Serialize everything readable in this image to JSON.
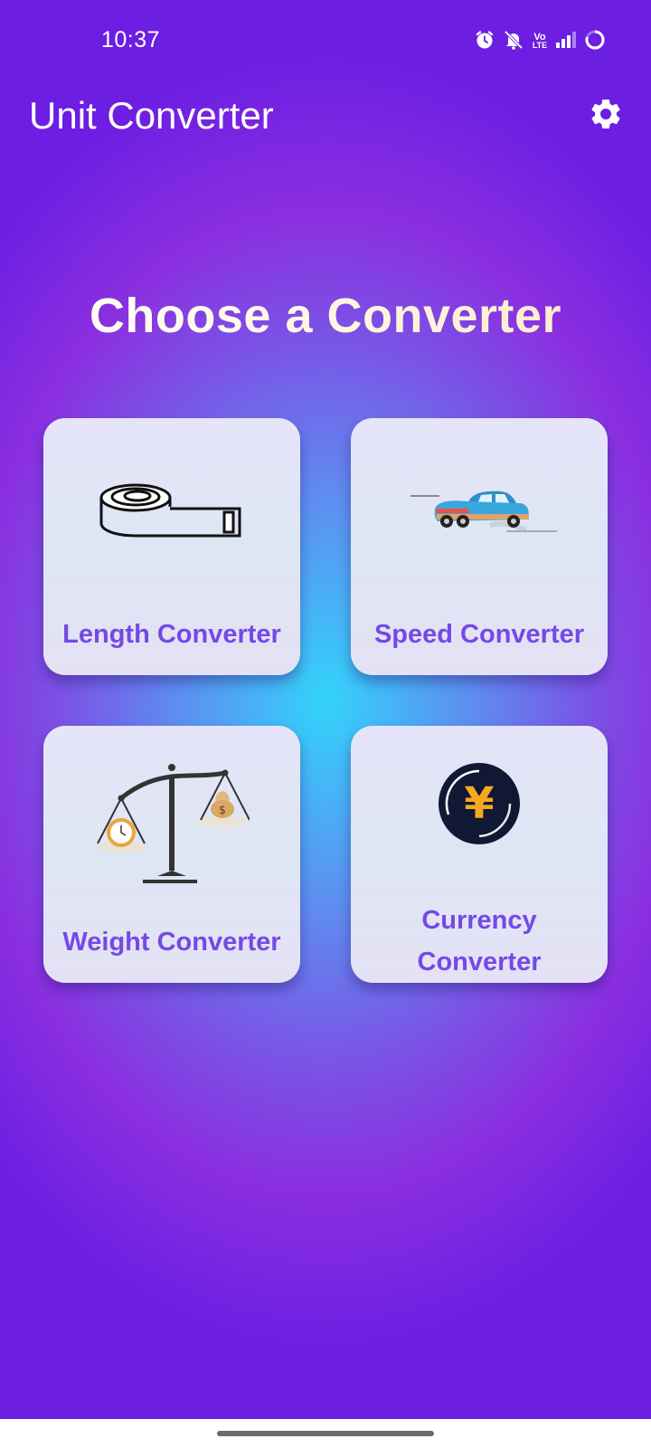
{
  "status_bar": {
    "time": "10:37",
    "icons": [
      "alarm-icon",
      "bell-muted-icon",
      "volte-icon",
      "signal-icon",
      "battery-ring-icon"
    ],
    "volte_top": "Vo",
    "volte_bottom": "LTE"
  },
  "app_bar": {
    "title": "Unit Converter",
    "settings_icon": "gear-icon"
  },
  "main": {
    "heading": "Choose a Converter",
    "cards": [
      {
        "label": "Length Converter",
        "icon": "measuring-tape-icon"
      },
      {
        "label": "Speed Converter",
        "icon": "moving-car-icon"
      },
      {
        "label": "Weight Converter",
        "icon": "balance-scale-icon"
      },
      {
        "label_line1": "Currency",
        "label_line2": "Converter",
        "icon": "yen-coin-icon",
        "coin_symbol": "¥"
      }
    ]
  },
  "colors": {
    "accent_text": "#7449e6",
    "background_center": "#33d3fb",
    "background_edge": "#6c1ee3"
  }
}
